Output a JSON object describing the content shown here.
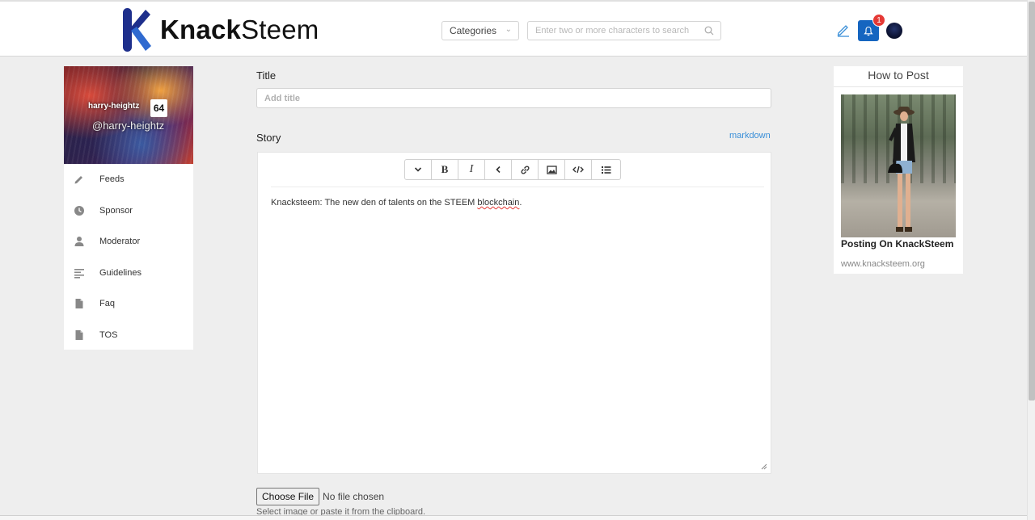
{
  "header": {
    "logo_text_bold": "Knack",
    "logo_text_light": "Steem",
    "categories_label": "Categories",
    "search_placeholder": "Enter two or more characters to search",
    "notification_count": "1"
  },
  "profile": {
    "name": "harry-heightz",
    "reputation": "64",
    "handle": "@harry-heightz"
  },
  "menu": {
    "items": [
      {
        "label": "Feeds",
        "icon": "pencil-icon"
      },
      {
        "label": "Sponsor",
        "icon": "clock-icon"
      },
      {
        "label": "Moderator",
        "icon": "user-icon"
      },
      {
        "label": "Guidelines",
        "icon": "align-left-icon"
      },
      {
        "label": "Faq",
        "icon": "file-icon"
      },
      {
        "label": "TOS",
        "icon": "file-icon"
      }
    ]
  },
  "editor": {
    "title_label": "Title",
    "title_placeholder": "Add title",
    "story_label": "Story",
    "markdown_link": "markdown",
    "toolbar": [
      "heading",
      "B",
      "I",
      "quote",
      "link",
      "image",
      "code",
      "list"
    ],
    "content_prefix": "Knacksteem: The new den of talents on the STEEM ",
    "content_word": "blockchain",
    "content_suffix": ".",
    "file_button": "Choose File",
    "file_status": "No file chosen",
    "file_hint": "Select image or paste it from the clipboard."
  },
  "howto": {
    "heading": "How to Post",
    "caption": "Posting On KnackSteem",
    "url": "www.knacksteem.org"
  },
  "colors": {
    "accent": "#1565c0",
    "link": "#3a8fd8",
    "badge": "#e53935"
  }
}
